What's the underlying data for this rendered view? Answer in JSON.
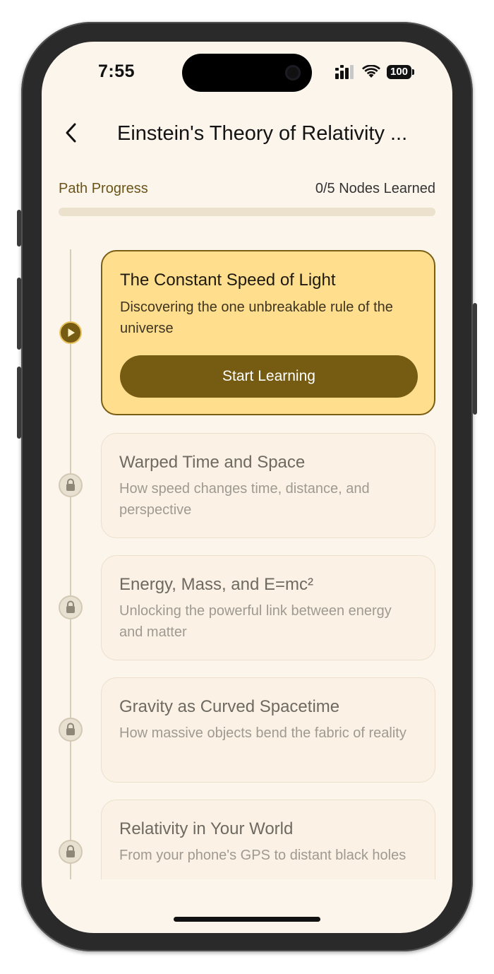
{
  "status_bar": {
    "time": "7:55",
    "battery": "100",
    "signal_icon": "cellular-signal-icon",
    "wifi_icon": "wifi-icon",
    "battery_icon": "battery-icon"
  },
  "header": {
    "back_icon": "chevron-left-icon",
    "title": "Einstein's Theory of Relativity ..."
  },
  "progress": {
    "label": "Path Progress",
    "count_text": "0/5 Nodes Learned",
    "learned": 0,
    "total": 5,
    "fraction": 0
  },
  "nodes": [
    {
      "title": "The Constant Speed of Light",
      "description": "Discovering the one unbreakable rule of the universe",
      "state": "active",
      "icon": "play-icon",
      "button_label": "Start Learning"
    },
    {
      "title": "Warped Time and Space",
      "description": "How speed changes time, distance, and perspective",
      "state": "locked",
      "icon": "lock-icon"
    },
    {
      "title": "Energy, Mass, and E=mc²",
      "description": "Unlocking the powerful link between energy and matter",
      "state": "locked",
      "icon": "lock-icon"
    },
    {
      "title": "Gravity as Curved Spacetime",
      "description": "How massive objects bend the fabric of reality",
      "state": "locked",
      "icon": "lock-icon"
    },
    {
      "title": "Relativity in Your World",
      "description": "From your phone's GPS to distant black holes",
      "state": "locked",
      "icon": "lock-icon"
    }
  ],
  "colors": {
    "accent": "#765c12",
    "active_card": "#ffdf8e",
    "background": "#fcf5ec"
  }
}
